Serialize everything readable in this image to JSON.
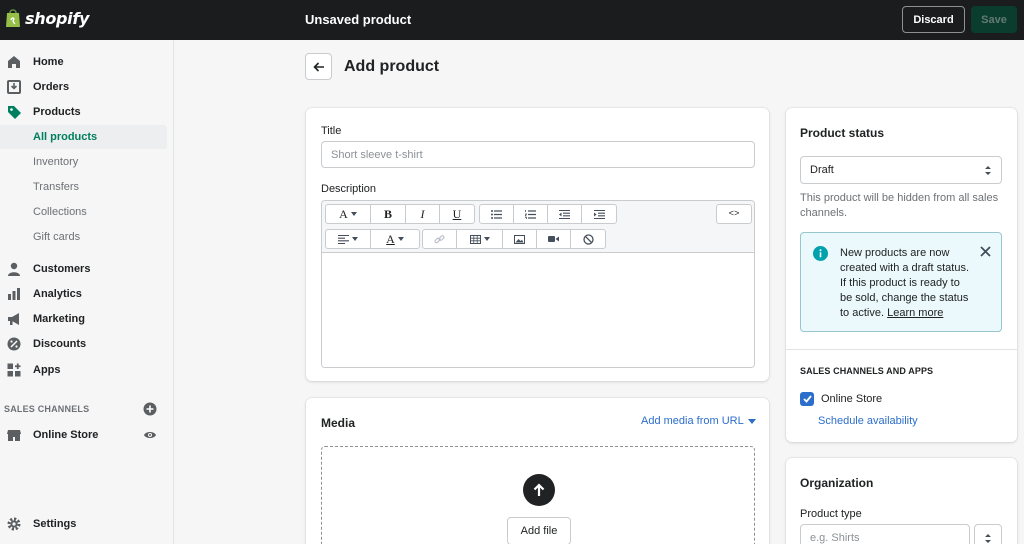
{
  "brand": {
    "name": "shopify"
  },
  "topbar": {
    "title": "Unsaved product",
    "discard_label": "Discard",
    "save_label": "Save"
  },
  "sidebar": {
    "items": [
      {
        "label": "Home",
        "icon": "home-icon"
      },
      {
        "label": "Orders",
        "icon": "orders-icon"
      },
      {
        "label": "Products",
        "icon": "tag-icon"
      }
    ],
    "product_subitems": [
      "All products",
      "Inventory",
      "Transfers",
      "Collections",
      "Gift cards"
    ],
    "active_subitem": "All products",
    "items2": [
      {
        "label": "Customers",
        "icon": "person-icon"
      },
      {
        "label": "Analytics",
        "icon": "bar-chart-icon"
      },
      {
        "label": "Marketing",
        "icon": "megaphone-icon"
      },
      {
        "label": "Discounts",
        "icon": "discount-icon"
      },
      {
        "label": "Apps",
        "icon": "apps-icon"
      }
    ],
    "sales_channels_label": "SALES CHANNELS",
    "online_store_label": "Online Store",
    "settings_label": "Settings"
  },
  "page": {
    "title": "Add product"
  },
  "product_form": {
    "title_label": "Title",
    "title_placeholder": "Short sleeve t-shirt",
    "title_value": "",
    "description_label": "Description"
  },
  "editor_toolbar": {
    "font_glyph": "A",
    "bold_glyph": "B",
    "italic_glyph": "I",
    "underline_glyph": "U",
    "source_glyph": "<>",
    "color_glyph": "A"
  },
  "media": {
    "title": "Media",
    "add_from_url_label": "Add media from URL",
    "add_file_label": "Add file"
  },
  "product_status": {
    "title": "Product status",
    "selected": "Draft",
    "help_text": "This product will be hidden from all sales channels.",
    "banner_text": "New products are now created with a draft status. If this product is ready to be sold, change the status to active.",
    "banner_link": "Learn more"
  },
  "sales_channels": {
    "title": "SALES CHANNELS AND APPS",
    "online_store_label": "Online Store",
    "online_store_checked": true,
    "schedule_label": "Schedule availability"
  },
  "organization": {
    "title": "Organization",
    "product_type_label": "Product type",
    "product_type_placeholder": "e.g. Shirts"
  },
  "colors": {
    "topbar_bg": "#1a1c1d",
    "accent_green": "#007f5f",
    "link_blue": "#2c6ecb",
    "banner_bg": "#ebf9fc"
  }
}
